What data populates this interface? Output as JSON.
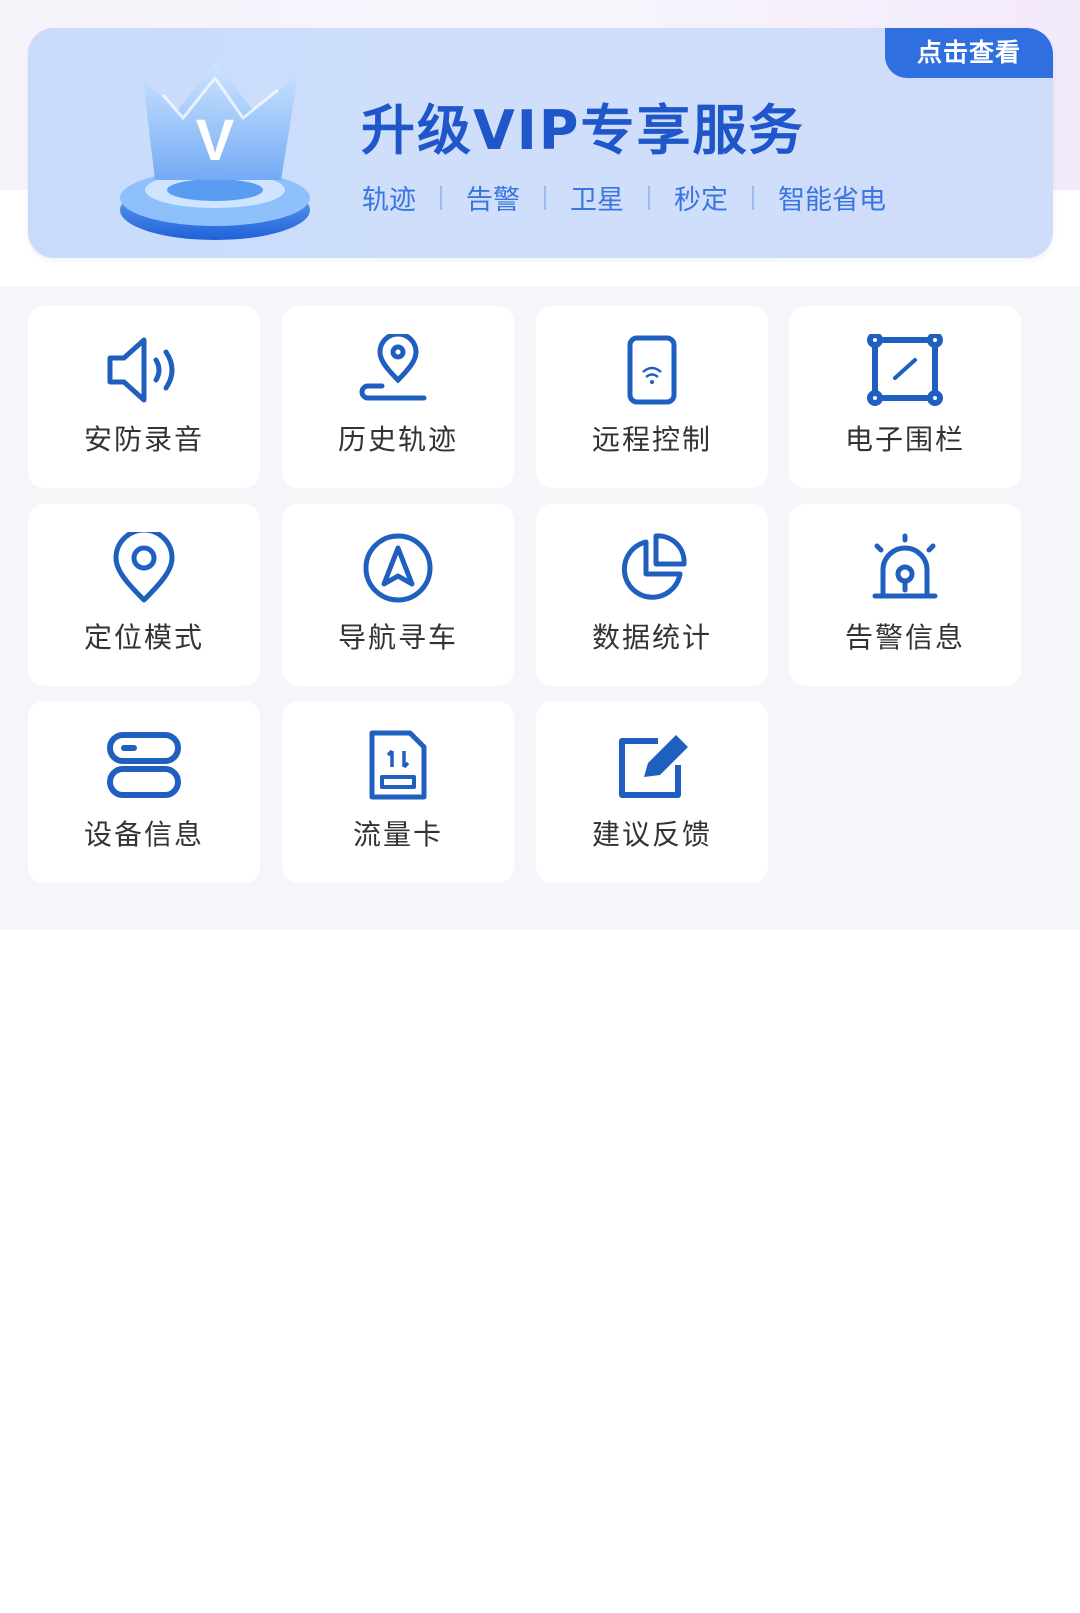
{
  "banner": {
    "tag_label": "点击查看",
    "title": "升级VIP专享服务",
    "features": [
      "轨迹",
      "告警",
      "卫星",
      "秒定",
      "智能省电"
    ]
  },
  "menu": {
    "items": [
      {
        "label": "安防录音",
        "icon": "speaker-icon"
      },
      {
        "label": "历史轨迹",
        "icon": "route-pin-icon"
      },
      {
        "label": "远程控制",
        "icon": "phone-wifi-icon"
      },
      {
        "label": "电子围栏",
        "icon": "geofence-icon"
      },
      {
        "label": "定位模式",
        "icon": "location-pin-icon"
      },
      {
        "label": "导航寻车",
        "icon": "navigation-arrow-icon"
      },
      {
        "label": "数据统计",
        "icon": "pie-chart-icon"
      },
      {
        "label": "告警信息",
        "icon": "alarm-siren-icon"
      },
      {
        "label": "设备信息",
        "icon": "device-stack-icon"
      },
      {
        "label": "流量卡",
        "icon": "sim-card-icon"
      },
      {
        "label": "建议反馈",
        "icon": "edit-feedback-icon"
      }
    ]
  },
  "colors": {
    "icon_blue": "#1f5fbf",
    "banner_title": "#1f56c9",
    "banner_tag_bg": "#2f6fe0"
  }
}
